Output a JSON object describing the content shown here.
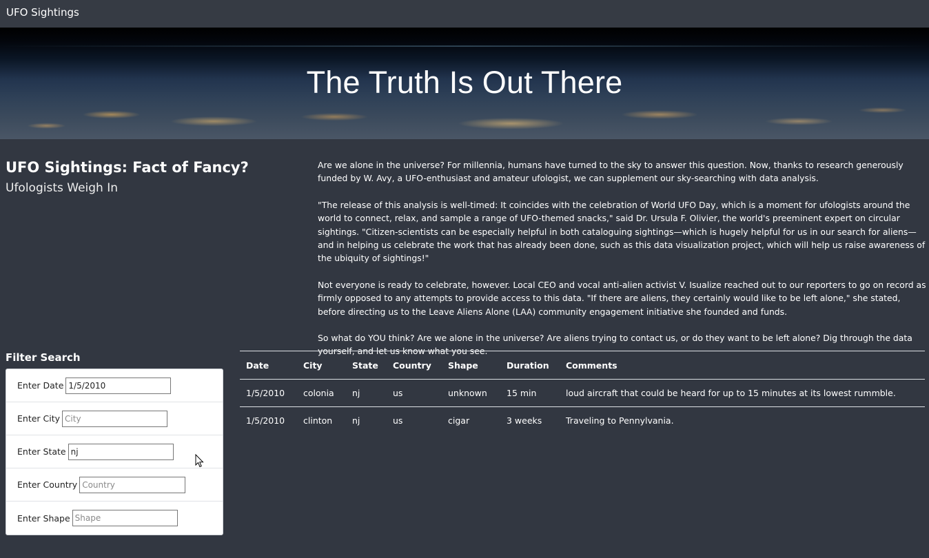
{
  "navbar": {
    "brand": "UFO Sightings"
  },
  "hero": {
    "title": "The Truth Is Out There"
  },
  "article": {
    "title_main": "UFO Sightings: Fact of Fancy?",
    "title_sub": "Ufologists Weigh In",
    "paragraphs": [
      "Are we alone in the universe? For millennia, humans have turned to the sky to answer this question. Now, thanks to research generously funded by W. Avy, a UFO-enthusiast and amateur ufologist, we can supplement our sky-searching with data analysis.",
      "\"The release of this analysis is well-timed: It coincides with the celebration of World UFO Day, which is a moment for ufologists around the world to connect, relax, and sample a range of UFO-themed snacks,\" said Dr. Ursula F. Olivier, the world's preeminent expert on circular sightings. \"Citizen-scientists can be especially helpful in both cataloguing sightings—which is hugely helpful for us in our search for aliens—and in helping us celebrate the work that has already been done, such as this data visualization project, which will help us raise awareness of the ubiquity of sightings!\"",
      "Not everyone is ready to celebrate, however. Local CEO and vocal anti-alien activist V. Isualize reached out to our reporters to go on record as firmly opposed to any attempts to provide access to this data. \"If there are aliens, they certainly would like to be left alone,\" she stated, before directing us to the Leave Aliens Alone (LAA) community engagement initiative she founded and funds.",
      "So what do YOU think? Are we alone in the universe? Are aliens trying to contact us, or do they want to be left alone? Dig through the data yourself, and let us know what you see."
    ]
  },
  "filters": {
    "heading": "Filter Search",
    "date": {
      "label": "Enter Date",
      "value": "1/5/2010",
      "placeholder": ""
    },
    "city": {
      "label": "Enter City",
      "value": "",
      "placeholder": "City"
    },
    "state": {
      "label": "Enter State",
      "value": "nj",
      "placeholder": ""
    },
    "country": {
      "label": "Enter Country",
      "value": "",
      "placeholder": "Country"
    },
    "shape": {
      "label": "Enter Shape",
      "value": "",
      "placeholder": "Shape"
    }
  },
  "table": {
    "headers": [
      "Date",
      "City",
      "State",
      "Country",
      "Shape",
      "Duration",
      "Comments"
    ],
    "rows": [
      [
        "1/5/2010",
        "colonia",
        "nj",
        "us",
        "unknown",
        "15 min",
        "loud aircraft that could be heard for up to 15 minutes at its lowest rummble."
      ],
      [
        "1/5/2010",
        "clinton",
        "nj",
        "us",
        "cigar",
        "3 weeks",
        "Traveling to Pennylvania."
      ]
    ]
  },
  "colors": {
    "page_background": "#323741",
    "navbar_background": "#363b44",
    "panel_background": "#ffffff"
  }
}
